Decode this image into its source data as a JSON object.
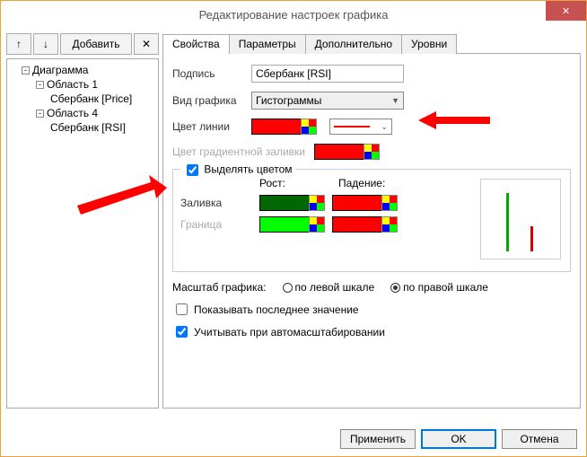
{
  "window": {
    "title": "Редактирование настроек графика"
  },
  "toolbar": {
    "add_label": "Добавить"
  },
  "tree": {
    "root": "Диаграмма",
    "area1": "Область 1",
    "item1": "Сбербанк [Price]",
    "area4": "Область 4",
    "item2": "Сбербанк [RSI]"
  },
  "tabs": {
    "t1": "Свойства",
    "t2": "Параметры",
    "t3": "Дополнительно",
    "t4": "Уровни"
  },
  "form": {
    "caption_label": "Подпись",
    "caption_value": "Сбербанк [RSI]",
    "type_label": "Вид графика",
    "type_value": "Гистограммы",
    "line_color_label": "Цвет линии",
    "gradient_label": "Цвет градиентной заливки",
    "highlight_label": "Выделять цветом",
    "growth_label": "Рост:",
    "fall_label": "Падение:",
    "fill_label": "Заливка",
    "border_label": "Граница",
    "scale_label": "Масштаб графика:",
    "scale_left": "по левой шкале",
    "scale_right": "по правой шкале",
    "show_last_label": "Показывать последнее значение",
    "autoscale_label": "Учитывать при автомасштабировании"
  },
  "buttons": {
    "apply": "Применить",
    "ok": "OK",
    "cancel": "Отмена"
  }
}
